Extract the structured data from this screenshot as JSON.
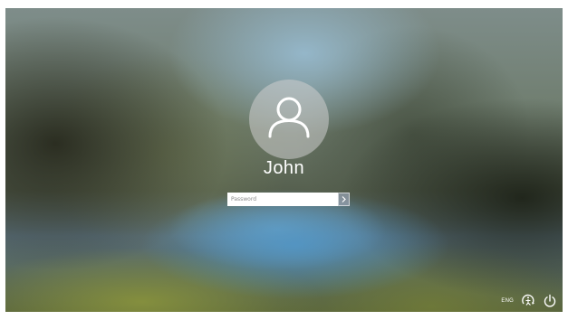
{
  "user": {
    "name": "John",
    "avatar_icon": "user-silhouette-icon"
  },
  "password": {
    "value": "",
    "placeholder": "Password",
    "submit_icon": "arrow-right-icon"
  },
  "tray": {
    "language": "ENG",
    "ease_of_access_icon": "ease-of-access-icon",
    "power_icon": "power-icon"
  },
  "colors": {
    "avatar_bg": "#c8c8c8",
    "text": "#ffffff",
    "submit_bg": "#96a0af"
  }
}
